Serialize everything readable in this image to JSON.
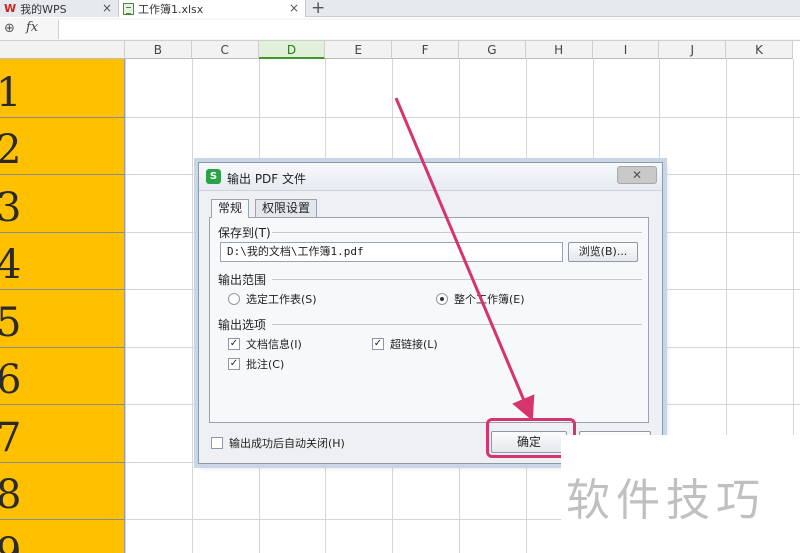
{
  "tabs": {
    "home_label": "我的WPS",
    "file_label": "工作簿1.xlsx",
    "close_glyph": "×",
    "add_glyph": "+"
  },
  "formula_bar": {
    "fx_label": "fx",
    "value": ""
  },
  "grid": {
    "columns": [
      "B",
      "C",
      "D",
      "E",
      "F",
      "G",
      "H",
      "I",
      "J",
      "K"
    ],
    "active_column": "D",
    "row_numbers": [
      "1",
      "2",
      "3",
      "4",
      "5",
      "6",
      "7",
      "8",
      "9"
    ],
    "colA_fill": "#ffc000"
  },
  "dialog": {
    "title": "输出 PDF 文件",
    "tabs": [
      "常规",
      "权限设置"
    ],
    "save_to_label": "保存到(T)",
    "path_value": "D:\\我的文档\\工作簿1.pdf",
    "browse_label": "浏览(B)...",
    "range_label": "输出范围",
    "radio_selected_sheet": "选定工作表(S)",
    "radio_whole_book": "整个工作簿(E)",
    "options_label": "输出选项",
    "opt_doc_info": "文档信息(I)",
    "opt_hyperlink": "超链接(L)",
    "opt_comments": "批注(C)",
    "auto_close_label": "输出成功后自动关闭(H)",
    "ok_label": "确定",
    "cancel_label": ""
  },
  "watermark": "软件技巧",
  "colors": {
    "arrow": "#d6336f",
    "accent_green": "#3d9a2a"
  }
}
